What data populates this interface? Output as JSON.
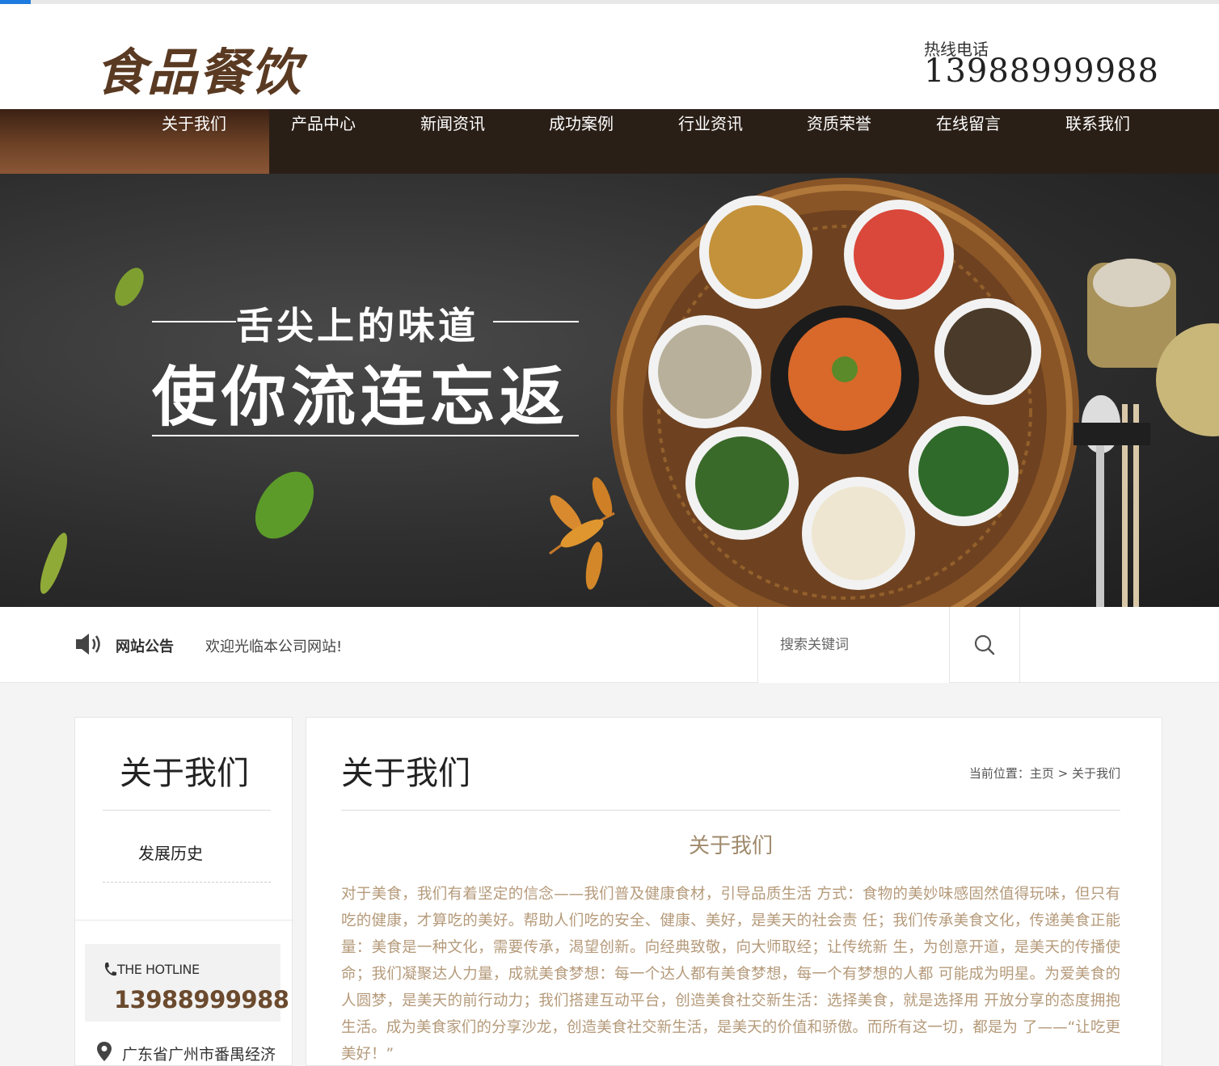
{
  "header": {
    "logo": "食品餐饮",
    "hotline_label": "热线电话",
    "hotline_number": "13988999988"
  },
  "nav": {
    "items": [
      {
        "label": "关于我们"
      },
      {
        "label": "产品中心"
      },
      {
        "label": "新闻资讯"
      },
      {
        "label": "成功案例"
      },
      {
        "label": "行业资讯"
      },
      {
        "label": "资质荣誉"
      },
      {
        "label": "在线留言"
      },
      {
        "label": "联系我们"
      }
    ],
    "active_index": 0
  },
  "banner": {
    "slogan_line1": "舌尖上的味道",
    "slogan_line2": "使你流连忘返"
  },
  "notice": {
    "label": "网站公告",
    "text": "欢迎光临本公司网站!",
    "search_placeholder": "搜索关键词"
  },
  "sidebar": {
    "title": "关于我们",
    "items": [
      {
        "label": "发展历史"
      }
    ],
    "hotline_label": "THE HOTLINE",
    "hotline_number": "13988999988",
    "address": "广东省广州市番禺经济"
  },
  "main": {
    "title": "关于我们",
    "breadcrumb": {
      "prefix": "当前位置：",
      "home": "主页",
      "separator": ">",
      "current": "关于我们"
    },
    "article_title": "关于我们",
    "article_body": " 对于美食，我们有着坚定的信念——我们普及健康食材，引导品质生活 方式：食物的美妙味感固然值得玩味，但只有吃的健康，才算吃的美好。帮助人们吃的安全、健康、美好，是美天的社会责 任；我们传承美食文化，传递美食正能量：美食是一种文化，需要传承，渴望创新。向经典致敬，向大师取经；让传统新 生，为创意开道，是美天的传播使命；我们凝聚达人力量，成就美食梦想：每一个达人都有美食梦想，每一个有梦想的人都 可能成为明星。为爱美食的人圆梦，是美天的前行动力；我们搭建互动平台，创造美食社交新生活：选择美食，就是选择用 开放分享的态度拥抱生活。成为美食家们的分享沙龙，创造美食社交新生活，是美天的价值和骄傲。而所有这一切，都是为 了——“让吃更美好！”"
  },
  "colors": {
    "nav_bg": "#2a1f17",
    "nav_active": "#6e4226",
    "accent_brown": "#6b4a2e",
    "article_text": "#b59a7a"
  }
}
